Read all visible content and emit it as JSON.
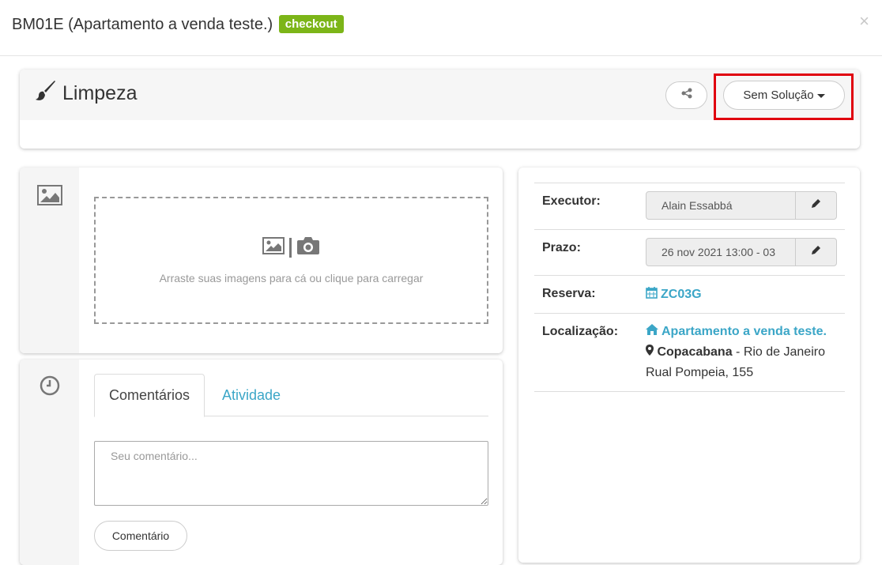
{
  "header": {
    "title": "BM01E (Apartamento a venda teste.)",
    "badge": "checkout",
    "close": "×"
  },
  "task": {
    "title": "Limpeza",
    "status_button": "Sem Solução"
  },
  "upload": {
    "text": "Arraste suas imagens para cá ou clique para carregar"
  },
  "comments": {
    "tabs": [
      "Comentários",
      "Atividade"
    ],
    "placeholder": "Seu comentário...",
    "button": "Comentário"
  },
  "details": {
    "executor_label": "Executor:",
    "executor_value": "Alain Essabbá",
    "deadline_label": "Prazo:",
    "deadline_value": "26 nov 2021 13:00 - 03",
    "booking_label": "Reserva:",
    "booking_value": "ZC03G",
    "location_label": "Localização:",
    "property_name": "Apartamento a venda teste.",
    "neighborhood": "Copacabana",
    "city_suffix": " - Rio de Janeiro",
    "street": "Rual Pompeia, 155"
  },
  "colors": {
    "badge": "#7cb518",
    "link": "#3ba6c7",
    "highlight": "#e0000f"
  }
}
